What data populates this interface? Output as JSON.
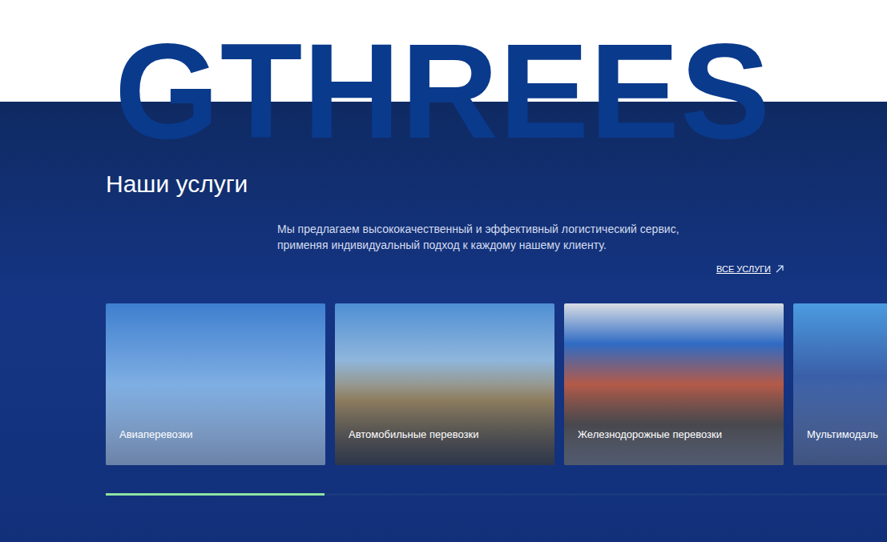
{
  "brand": "GTHREES",
  "section": {
    "title": "Наши услуги",
    "description": [
      "Мы предлагаем высококачественный и эффективный логистический сервис,",
      "применяя индивидуальный подход к каждому нашему клиенту."
    ],
    "link": "ВСЕ УСЛУГИ"
  },
  "cards": [
    {
      "label": "Авиаперевозки"
    },
    {
      "label": "Автомобильные перевозки"
    },
    {
      "label": "Железнодорожные перевозки"
    },
    {
      "label": "Мультимодаль"
    }
  ],
  "carousel": {
    "level": 0.28
  }
}
